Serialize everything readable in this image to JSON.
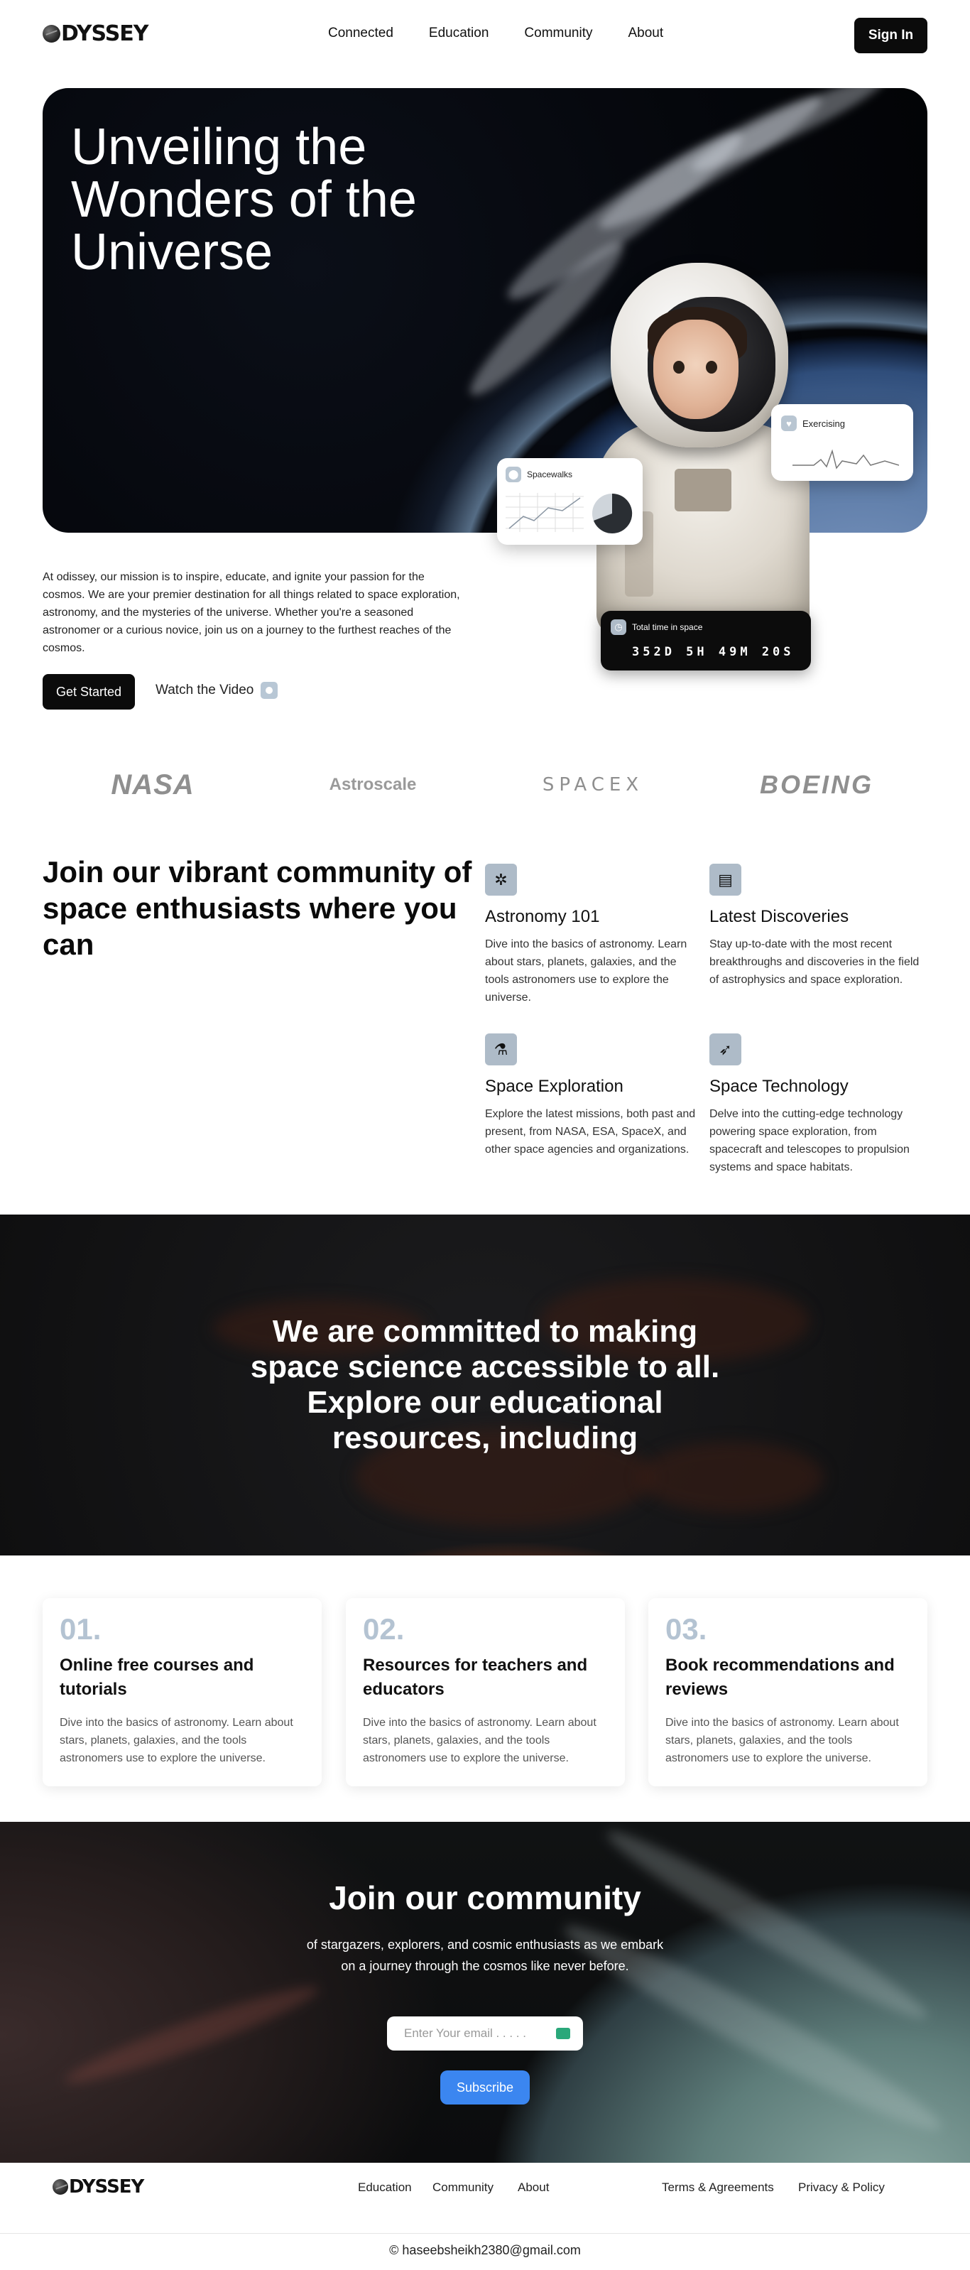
{
  "nav": {
    "logo": "DYSSEY",
    "links": [
      "Connected",
      "Education",
      "Community",
      "About"
    ],
    "signin": "Sign In"
  },
  "hero": {
    "title": "Unveiling the Wonders of the Universe",
    "cards": {
      "exercising": "Exercising",
      "spacewalks": "Spacewalks",
      "total_time_label": "Total time in space",
      "total_time_value": "352D 5H 49M 20S"
    }
  },
  "intro": {
    "text": "At odissey, our mission is to inspire, educate, and ignite your passion for the cosmos. We are your premier destination for all things related to space exploration, astronomy, and the mysteries of the universe. Whether you're a seasoned astronomer or a curious novice, join us on a journey to the furthest reaches of the cosmos.",
    "get_started": "Get Started",
    "watch_video": "Watch the Video"
  },
  "partners": [
    "NASA",
    "Astroscale",
    "SPACEX",
    "BOEING"
  ],
  "community": {
    "title": "Join our vibrant community of space enthusiasts where you can",
    "features": [
      {
        "icon": "atom-icon",
        "title": "Astronomy 101",
        "text": "Dive into the basics of astronomy. Learn about stars, planets, galaxies, and the tools astronomers use to explore the universe."
      },
      {
        "icon": "clipboard-icon",
        "title": "Latest Discoveries",
        "text": "Stay up-to-date with the most recent breakthroughs and discoveries in the field of astrophysics and space exploration."
      },
      {
        "icon": "microscope-icon",
        "title": "Space Exploration",
        "text": "Explore the latest missions, both past and present, from NASA, ESA, SpaceX, and other space agencies and organizations."
      },
      {
        "icon": "rocket-icon",
        "title": "Space Technology",
        "text": "Delve into the cutting-edge technology powering space exploration, from spacecraft and telescopes to propulsion systems and space habitats."
      }
    ]
  },
  "mars": {
    "title": "We are committed to making space science accessible to all. Explore our educational resources, including"
  },
  "resources": [
    {
      "num": "01.",
      "title": "Online free courses and tutorials",
      "text": "Dive into the basics of astronomy. Learn about stars, planets, galaxies, and the tools astronomers use to explore the universe."
    },
    {
      "num": "02.",
      "title": "Resources for teachers and educators",
      "text": "Dive into the basics of astronomy. Learn about stars, planets, galaxies, and the tools astronomers use to explore the universe."
    },
    {
      "num": "03.",
      "title": "Book recommendations and reviews",
      "text": "Dive into the basics of astronomy. Learn about stars, planets, galaxies, and the tools astronomers use to explore the universe."
    }
  ],
  "join": {
    "title": "Join our community",
    "subtitle": "of stargazers, explorers, and cosmic enthusiasts as we embark on a journey through the cosmos like never before.",
    "email_placeholder": "Enter Your email . . . . .",
    "subscribe": "Subscribe"
  },
  "footer": {
    "logo": "DYSSEY",
    "links": [
      "Education",
      "Community",
      "About"
    ],
    "legal": [
      "Terms & Agreements",
      "Privacy & Policy"
    ],
    "copyright": "© haseebsheikh2380@gmail.com"
  },
  "colors": {
    "accent_blue": "#3b86f0",
    "dark": "#0b0b0b",
    "number_blue": "#b4c3d2"
  }
}
